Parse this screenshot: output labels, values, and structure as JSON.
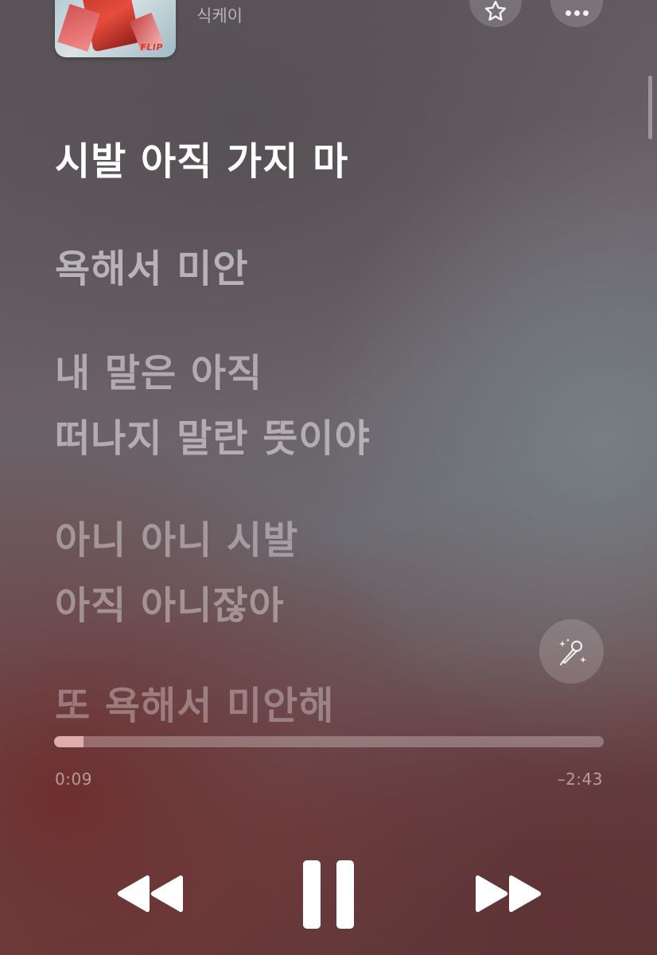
{
  "header": {
    "artist": "식케이",
    "album_logo": "FLIP",
    "favorite_icon": "star-icon",
    "more_icon": "ellipsis-icon"
  },
  "lyrics": {
    "line1": "시발 아직 가지 마",
    "line2": "욕해서 미안",
    "line3a": "내 말은 아직",
    "line3b": "떠나지 말란 뜻이야",
    "line4a": "아니 아니 시발",
    "line4b": "아직 아니잖아",
    "line5": "또 욕해서 미안해"
  },
  "karaoke": {
    "icon": "microphone-sparkle-icon"
  },
  "playback": {
    "elapsed": "0:09",
    "remaining": "–2:43",
    "progress": 0.054
  },
  "controls": {
    "rewind_icon": "rewind-icon",
    "pause_icon": "pause-icon",
    "forward_icon": "fast-forward-icon"
  },
  "colors": {
    "progress_fill": "#f0b9b9",
    "accent_bg": "#6b4446"
  }
}
